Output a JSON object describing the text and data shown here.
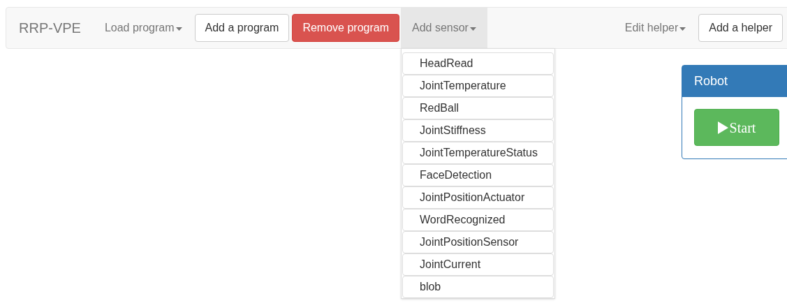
{
  "navbar": {
    "brand": "RRP-VPE",
    "left": [
      {
        "kind": "dropdown",
        "label": "Load program",
        "expanded": false
      },
      {
        "kind": "button",
        "label": "Add a program"
      },
      {
        "kind": "danger",
        "label": "Remove program"
      },
      {
        "kind": "dropdown",
        "label": "Add sensor",
        "expanded": true,
        "menu": [
          "HeadRead",
          "JointTemperature",
          "RedBall",
          "JointStiffness",
          "JointTemperatureStatus",
          "FaceDetection",
          "JointPositionActuator",
          "WordRecognized",
          "JointPositionSensor",
          "JointCurrent",
          "blob"
        ]
      }
    ],
    "right": [
      {
        "kind": "dropdown",
        "label": "Edit helper",
        "expanded": false
      },
      {
        "kind": "button",
        "label": "Add a helper"
      }
    ]
  },
  "panel": {
    "title": "Robot",
    "button": "Start"
  }
}
